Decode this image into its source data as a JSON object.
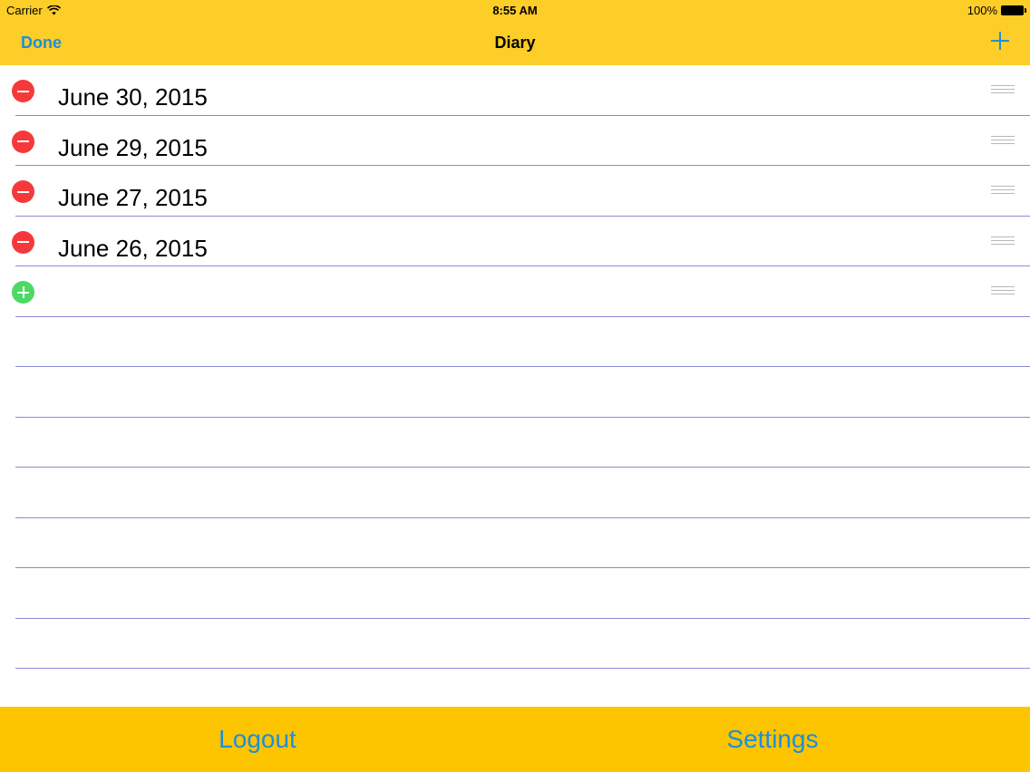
{
  "status_bar": {
    "carrier": "Carrier",
    "time": "8:55 AM",
    "battery": "100%"
  },
  "nav_bar": {
    "done_label": "Done",
    "title": "Diary",
    "add_icon": "plus-icon"
  },
  "entries": [
    {
      "label": "June 30, 2015",
      "action_icon": "delete-icon"
    },
    {
      "label": "June 29, 2015",
      "action_icon": "delete-icon"
    },
    {
      "label": "June 27, 2015",
      "action_icon": "delete-icon"
    },
    {
      "label": "June 26, 2015",
      "action_icon": "delete-icon"
    },
    {
      "label": "",
      "action_icon": "insert-icon"
    }
  ],
  "toolbar": {
    "logout_label": "Logout",
    "settings_label": "Settings"
  },
  "colors": {
    "bar_yellow": "#fdcd28",
    "toolbar_yellow": "#fdc400",
    "accent_blue": "#1d8fd8",
    "delete_red": "#f5393a",
    "insert_green": "#4cd964",
    "rule_line": "#8a8ad6"
  }
}
